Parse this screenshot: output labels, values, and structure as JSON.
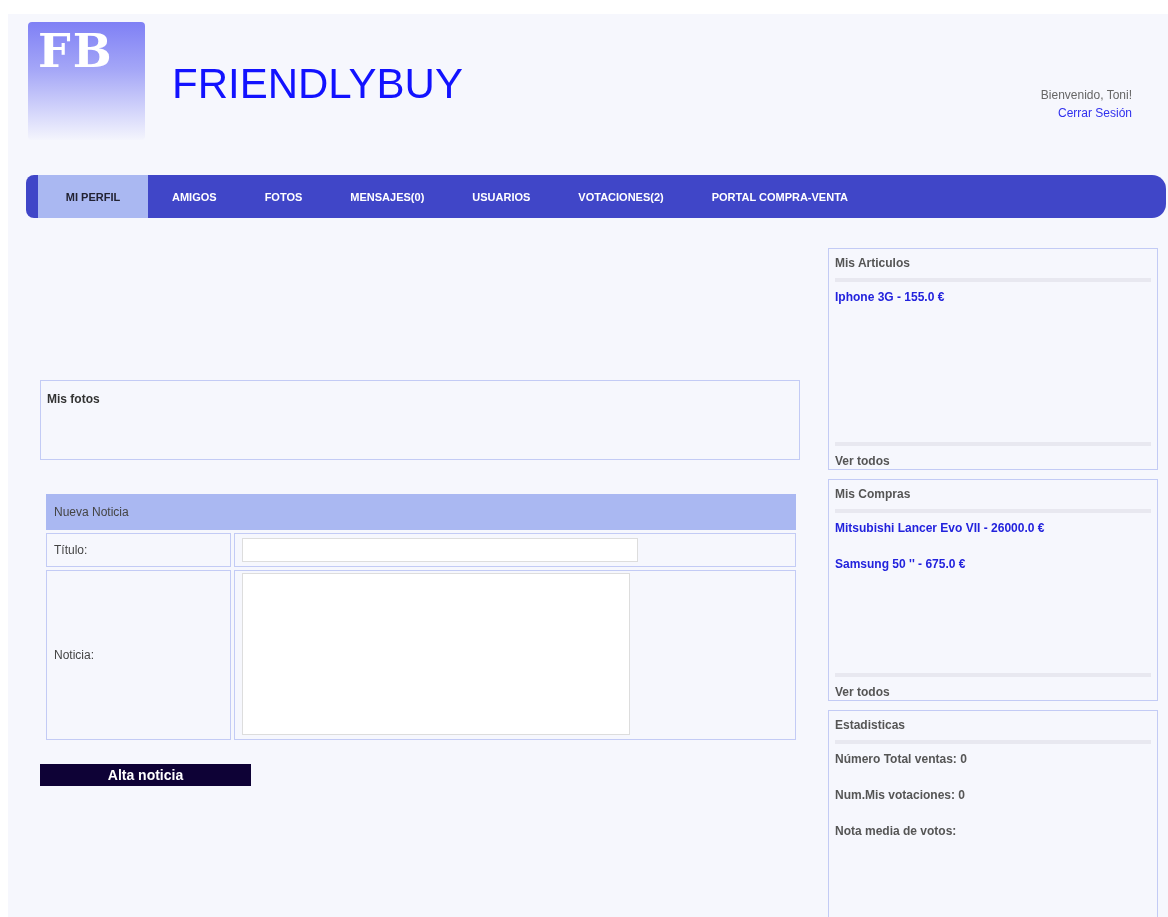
{
  "header": {
    "logo": "FB",
    "title": "FRIENDLYBUY",
    "welcome": "Bienvenido, Toni!",
    "logout": "Cerrar Sesión"
  },
  "nav": [
    {
      "label": "MI PERFIL",
      "selected": true
    },
    {
      "label": "AMIGOS",
      "selected": false
    },
    {
      "label": "FOTOS",
      "selected": false
    },
    {
      "label": "MENSAJES(0)",
      "selected": false
    },
    {
      "label": "USUARIOS",
      "selected": false
    },
    {
      "label": "VOTACIONES(2)",
      "selected": false
    },
    {
      "label": "PORTAL COMPRA-VENTA",
      "selected": false
    }
  ],
  "photos": {
    "title": "Mis fotos"
  },
  "news_form": {
    "title": "Nueva Noticia",
    "title_label": "Título:",
    "body_label": "Noticia:",
    "submit": "Alta noticia"
  },
  "sidebar": [
    {
      "title": "Mis Articulos",
      "kind": "links",
      "items": [
        "Iphone 3G - 155.0 €"
      ],
      "footer": "Ver todos"
    },
    {
      "title": "Mis Compras",
      "kind": "links",
      "items": [
        "Mitsubishi Lancer Evo VII - 26000.0 €",
        "Samsung 50 '' - 675.0 €"
      ],
      "footer": "Ver todos"
    },
    {
      "title": "Estadisticas",
      "kind": "stats",
      "items": [
        "Número Total ventas: 0",
        "Num.Mis votaciones: 0",
        "Nota media de votos:"
      ]
    }
  ]
}
